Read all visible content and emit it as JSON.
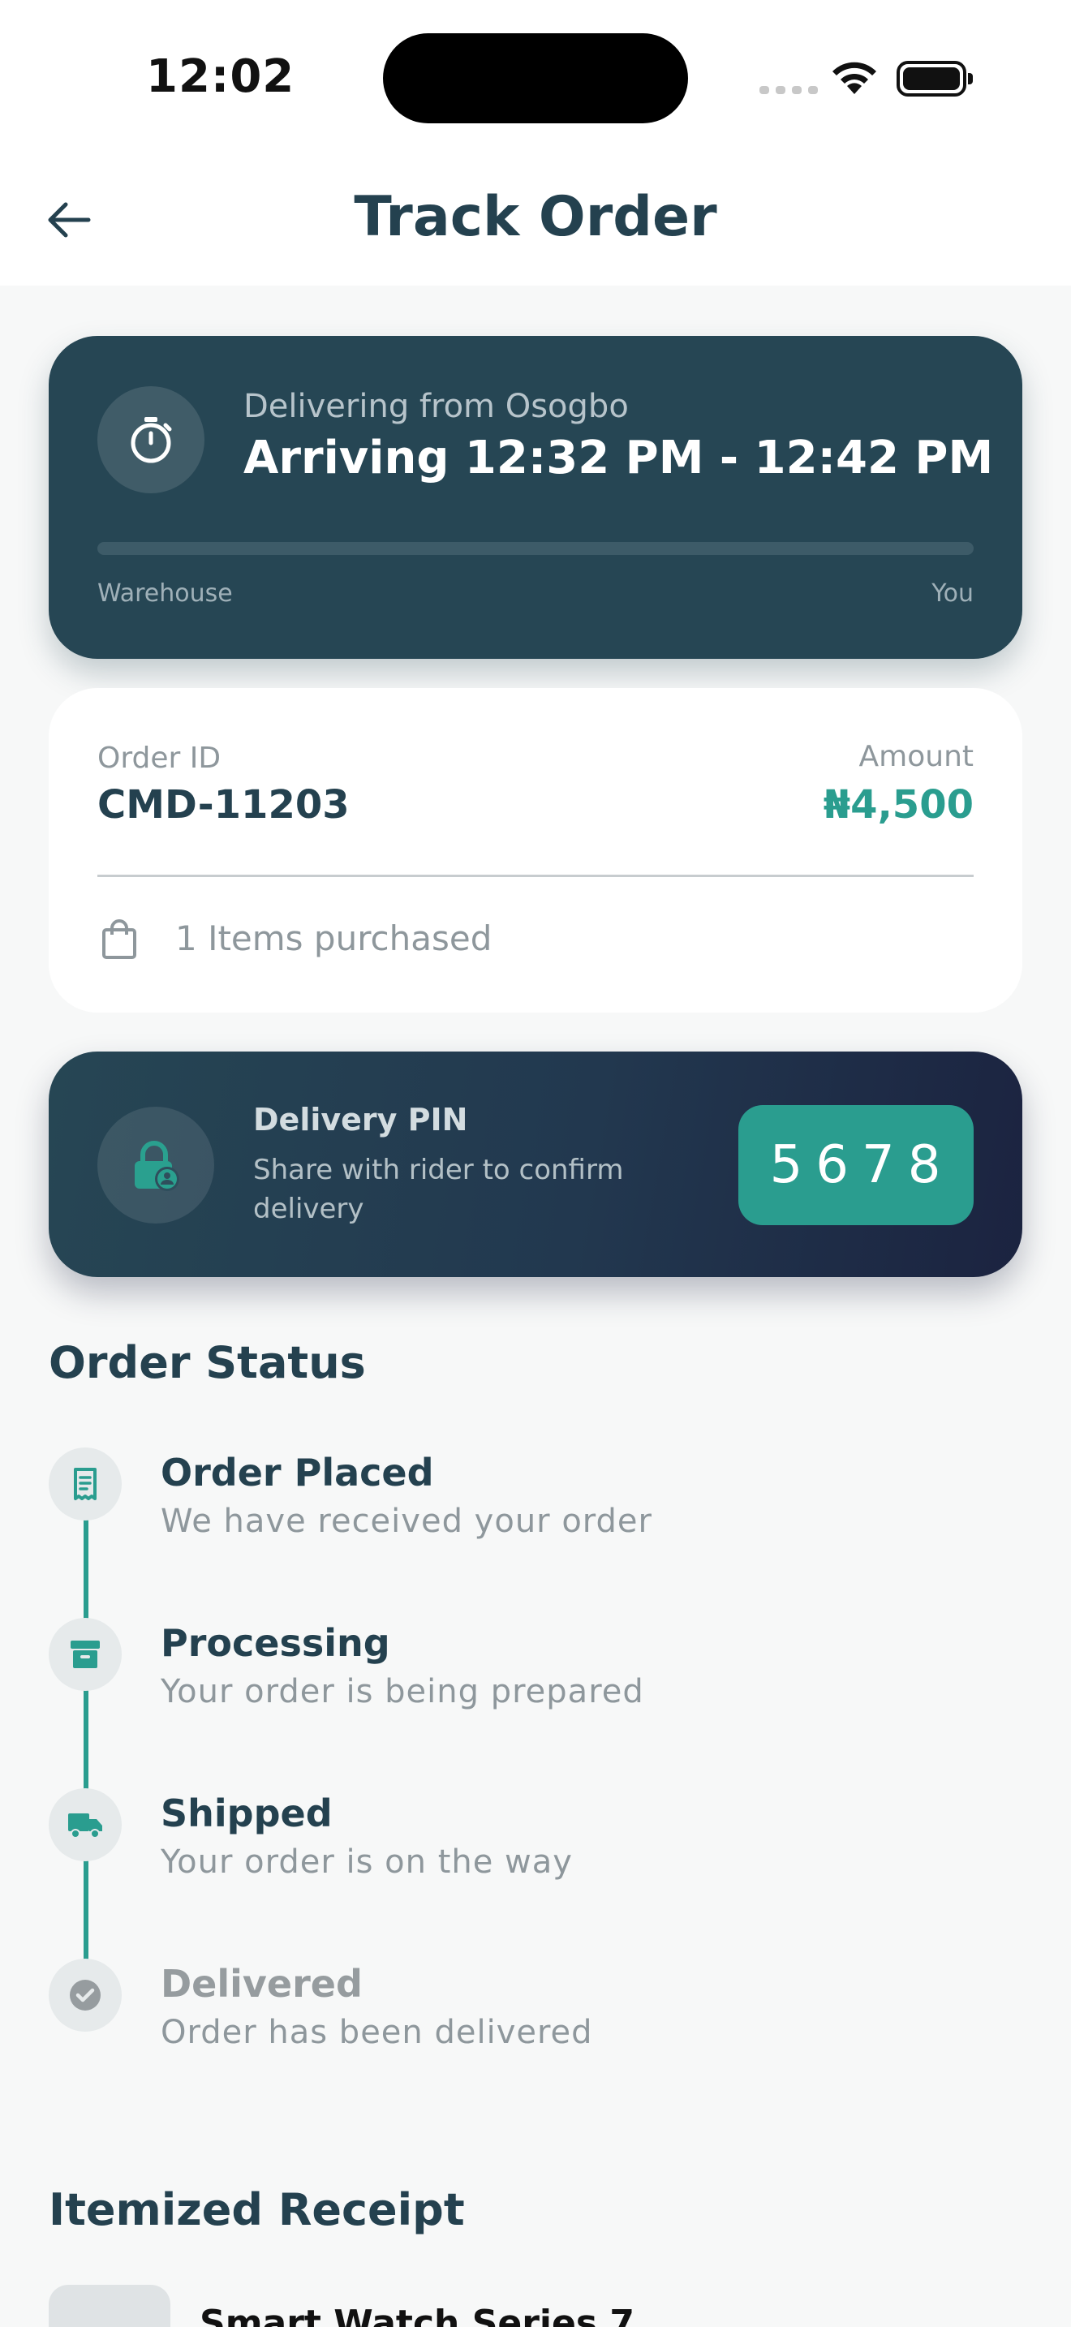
{
  "status_bar": {
    "time": "12:02"
  },
  "header": {
    "title": "Track Order"
  },
  "eta_card": {
    "from_text": "Delivering from Osogbo",
    "arrival_text": "Arriving 12:32 PM - 12:42 PM",
    "progress": 0.0,
    "start_label": "Warehouse",
    "end_label": "You"
  },
  "order_card": {
    "id_label": "Order ID",
    "id_value": "CMD-11203",
    "amount_label": "Amount",
    "amount_value": "₦4,500",
    "items_text": "1 Items purchased"
  },
  "pin_card": {
    "title": "Delivery PIN",
    "subtitle": "Share with rider to confirm delivery",
    "code": "5678"
  },
  "order_status": {
    "title": "Order Status",
    "steps": [
      {
        "icon": "receipt-icon",
        "title": "Order Placed",
        "subtitle": "We have received your order",
        "done": true
      },
      {
        "icon": "archive-box-icon",
        "title": "Processing",
        "subtitle": "Your order is being prepared",
        "done": true
      },
      {
        "icon": "truck-icon",
        "title": "Shipped",
        "subtitle": "Your order is on the way",
        "done": true
      },
      {
        "icon": "check-circle-icon",
        "title": "Delivered",
        "subtitle": "Order has been delivered",
        "done": false
      }
    ]
  },
  "receipt": {
    "title": "Itemized Receipt",
    "items": [
      {
        "name": "Smart Watch Series 7"
      }
    ]
  },
  "colors": {
    "primary_dark": "#264654",
    "accent": "#2a9d8f",
    "background": "#f7f8f8"
  }
}
